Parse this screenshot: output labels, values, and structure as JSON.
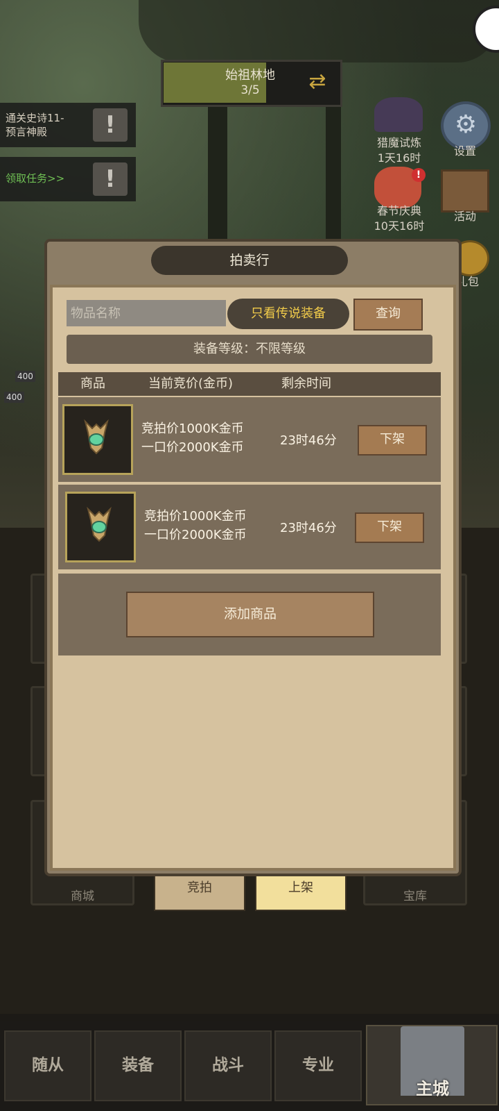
{
  "hud": {
    "area_name": "始祖林地",
    "area_progress": "3/5",
    "quest1": "通关史诗11-\n预言神殿",
    "quest2": "领取任务>>",
    "excl": "!",
    "side": {
      "trial": "猎魔试炼",
      "trial_time": "1天16时",
      "settings": "设置",
      "festival": "春节庆典",
      "festival_time": "10天16时",
      "activity": "活动",
      "gift": "礼包"
    },
    "hp_tags": [
      "400",
      "400"
    ]
  },
  "modal": {
    "title": "拍卖行",
    "search_placeholder": "物品名称",
    "legend_toggle": "只看传说装备",
    "query_button": "查询",
    "level_filter": "装备等级：不限等级",
    "headers": {
      "item": "商品",
      "price": "当前竞价(金币)",
      "time": "剩余时间"
    },
    "rows": [
      {
        "bid": "竞拍价1000K金币",
        "buyout": "一口价2000K金币",
        "time": "23时46分",
        "action": "下架"
      },
      {
        "bid": "竞拍价1000K金币",
        "buyout": "一口价2000K金币",
        "time": "23时46分",
        "action": "下架"
      }
    ],
    "add_button": "添加商品"
  },
  "tabs": {
    "bid": "竞拍",
    "list": "上架"
  },
  "lower_labels": {
    "shop": "商城",
    "vault": "宝库"
  },
  "nav": [
    "随从",
    "装备",
    "战斗",
    "专业",
    "主城"
  ]
}
